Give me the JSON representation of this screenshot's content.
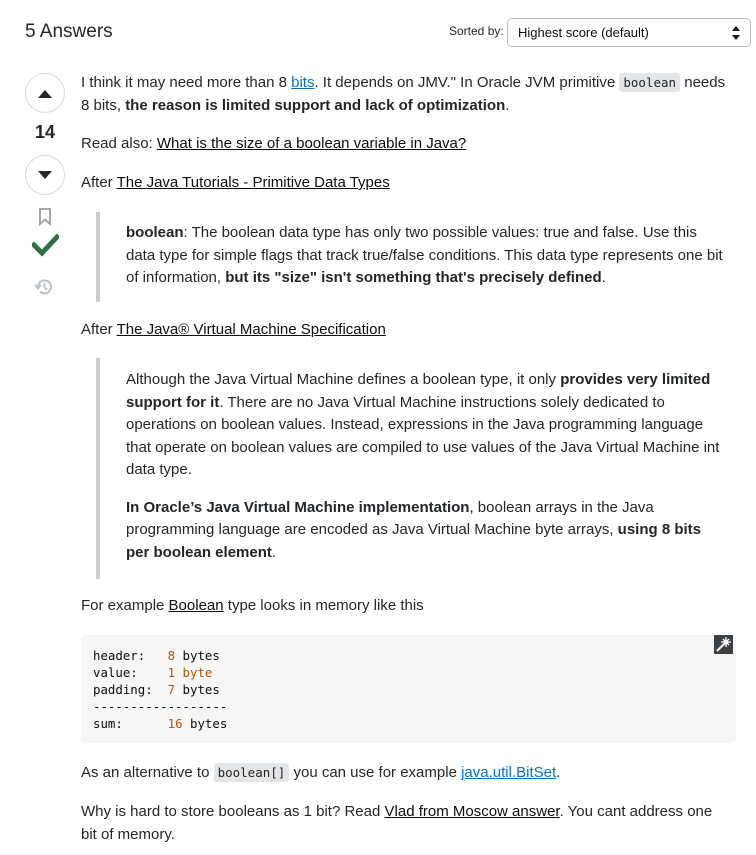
{
  "header": {
    "answers_count": "5 Answers",
    "sorted_label": "Sorted by:",
    "sort_value": "Highest score (default)"
  },
  "vote": {
    "count": "14"
  },
  "colors": {
    "accept": "#2f6f44",
    "link": "#0074cc",
    "number": "#b75301"
  },
  "icons": [
    "upvote-icon",
    "downvote-icon",
    "bookmark-icon",
    "accepted-check-icon",
    "history-icon",
    "copy-code-icon"
  ],
  "answer": {
    "p1": {
      "t1": "I think it may need more than 8 ",
      "link1": "bits",
      "t2": ". It depends on JMV.\" In Oracle JVM primitive ",
      "code": "boolean",
      "t3": " needs 8 bits, ",
      "bold": "the reason is limited support and lack of optimization",
      "t4": "."
    },
    "p2": {
      "t1": "Read also: ",
      "link": "What is the size of a boolean variable in Java?"
    },
    "p3": {
      "t1": "After ",
      "link": "The Java Tutorials - Primitive Data Types"
    },
    "quote1": {
      "bold1": "boolean",
      "t1": ": The boolean data type has only two possible values: true and false. Use this data type for simple flags that track true/false conditions. This data type represents one bit of information, ",
      "bold2": "but its \"size\" isn't something that's precisely defined",
      "t2": "."
    },
    "p4": {
      "t1": "After ",
      "link": "The Java® Virtual Machine Specification"
    },
    "quote2": {
      "a_t1": "Although the Java Virtual Machine defines a boolean type, it only ",
      "a_bold": "provides very limited support for it",
      "a_t2": ". There are no Java Virtual Machine instructions solely dedicated to operations on boolean values. Instead, expressions in the Java programming language that operate on boolean values are compiled to use values of the Java Virtual Machine int data type.",
      "b_bold1": "In Oracle’s Java Virtual Machine implementation",
      "b_t1": ", boolean arrays in the Java programming language are encoded as Java Virtual Machine byte arrays, ",
      "b_bold2": "using 8 bits per boolean element",
      "b_t2": "."
    },
    "p5": {
      "t1": "For example ",
      "link": "Boolean",
      "t2": " type looks in memory like this"
    },
    "code_block": {
      "l1a": "header:   ",
      "l1n": "8",
      "l1b": " bytes",
      "l2a": "value:    ",
      "l2n": "1",
      "l2b": " byte",
      "l3a": "padding:  ",
      "l3n": "7",
      "l3b": " bytes",
      "l4": "------------------",
      "l5a": "sum:      ",
      "l5n": "16",
      "l5b": " bytes"
    },
    "p6": {
      "t1": "As an alternative to ",
      "code": "boolean[]",
      "t2": " you can use for example ",
      "link": "java.util.BitSet",
      "t3": "."
    },
    "p7": {
      "t1": "Why is hard to store booleans as 1 bit? Read ",
      "link": "Vlad from Moscow answer",
      "t2": ". You cant address one bit of memory."
    }
  }
}
